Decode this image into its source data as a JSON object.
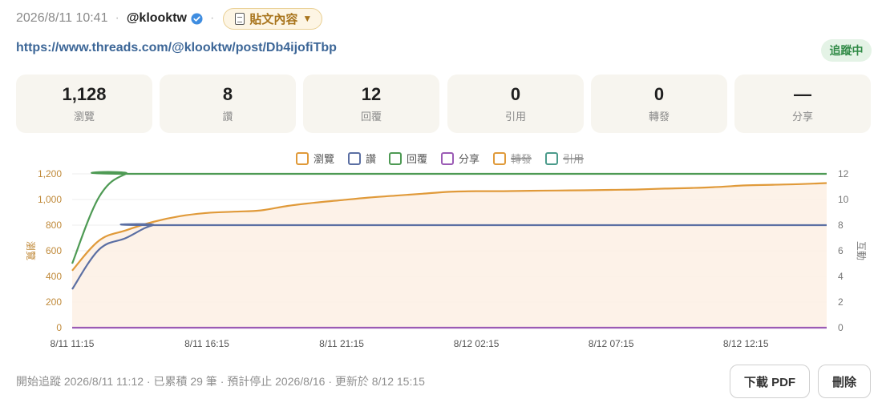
{
  "header": {
    "datetime": "2026/8/11 10:41",
    "username": "@klooktw",
    "post_button_label": "貼文內容",
    "post_button_caret": "▼"
  },
  "url": "https://www.threads.com/@klooktw/post/Db4ijofiTbp",
  "status_badge": "追蹤中",
  "stats": [
    {
      "value": "1,128",
      "label": "瀏覽"
    },
    {
      "value": "8",
      "label": "讚"
    },
    {
      "value": "12",
      "label": "回覆"
    },
    {
      "value": "0",
      "label": "引用"
    },
    {
      "value": "0",
      "label": "轉發"
    },
    {
      "value": "—",
      "label": "分享"
    }
  ],
  "chart_data": {
    "type": "line",
    "x_ticks": [
      "8/11 11:15",
      "8/11 16:15",
      "8/11 21:15",
      "8/12 02:15",
      "8/12 07:15",
      "8/12 12:15"
    ],
    "x_range": [
      "8/11 11:15",
      "8/12 15:15"
    ],
    "ylabel_left": "瀏覽",
    "ylabel_right": "互動",
    "ylim_left": [
      0,
      1200
    ],
    "ylim_right": [
      0,
      12
    ],
    "y_ticks_left": [
      "0",
      "200",
      "400",
      "600",
      "800",
      "1,000",
      "1,200"
    ],
    "y_ticks_right": [
      "0",
      "2",
      "4",
      "6",
      "8",
      "10",
      "12"
    ],
    "legend_position": "top-center",
    "series": [
      {
        "name": "瀏覽",
        "axis": "left",
        "color": "#e09a3a",
        "fill": true,
        "hidden": false,
        "x": [
          "8/11 11:15",
          "8/11 12:15",
          "8/11 13:15",
          "8/11 14:15",
          "8/11 15:15",
          "8/11 16:15",
          "8/11 17:15",
          "8/11 18:15",
          "8/11 19:15",
          "8/11 20:15",
          "8/11 21:15",
          "8/11 22:15",
          "8/11 23:15",
          "8/12 00:15",
          "8/12 01:15",
          "8/12 02:15",
          "8/12 03:15",
          "8/12 04:15",
          "8/12 05:15",
          "8/12 06:15",
          "8/12 07:15",
          "8/12 08:15",
          "8/12 09:15",
          "8/12 10:15",
          "8/12 11:15",
          "8/12 12:15",
          "8/12 13:15",
          "8/12 14:15",
          "8/12 15:15"
        ],
        "values": [
          445,
          680,
          760,
          825,
          870,
          895,
          905,
          915,
          950,
          975,
          995,
          1015,
          1030,
          1045,
          1060,
          1065,
          1065,
          1068,
          1070,
          1072,
          1075,
          1078,
          1085,
          1090,
          1098,
          1110,
          1115,
          1120,
          1128
        ]
      },
      {
        "name": "讚",
        "axis": "right",
        "color": "#5b6fa3",
        "fill": false,
        "hidden": false,
        "x": [
          "8/11 11:15",
          "8/11 12:15",
          "8/11 13:15",
          "8/11 14:15",
          "8/11 15:15",
          "8/12 15:15"
        ],
        "values": [
          3,
          6.1,
          7,
          8,
          8,
          8
        ]
      },
      {
        "name": "回覆",
        "axis": "right",
        "color": "#4e9a54",
        "fill": false,
        "hidden": false,
        "x": [
          "8/11 11:15",
          "8/11 12:15",
          "8/11 13:15",
          "8/11 14:15",
          "8/12 15:15"
        ],
        "values": [
          5,
          10.2,
          12,
          12,
          12
        ]
      },
      {
        "name": "分享",
        "axis": "right",
        "color": "#9b5bb5",
        "fill": false,
        "hidden": false,
        "x": [
          "8/11 11:15",
          "8/12 15:15"
        ],
        "values": [
          0,
          0
        ]
      },
      {
        "name": "轉發",
        "axis": "right",
        "color": "#e09a3a",
        "fill": false,
        "hidden": true
      },
      {
        "name": "引用",
        "axis": "right",
        "color": "#4b9b8b",
        "fill": false,
        "hidden": true
      }
    ]
  },
  "footer": {
    "info": "開始追蹤 2026/8/11 11:12 · 已累積 29 筆 · 預計停止 2026/8/16 · 更新於 8/12 15:15",
    "download_label": "下載 PDF",
    "delete_label": "刪除"
  }
}
